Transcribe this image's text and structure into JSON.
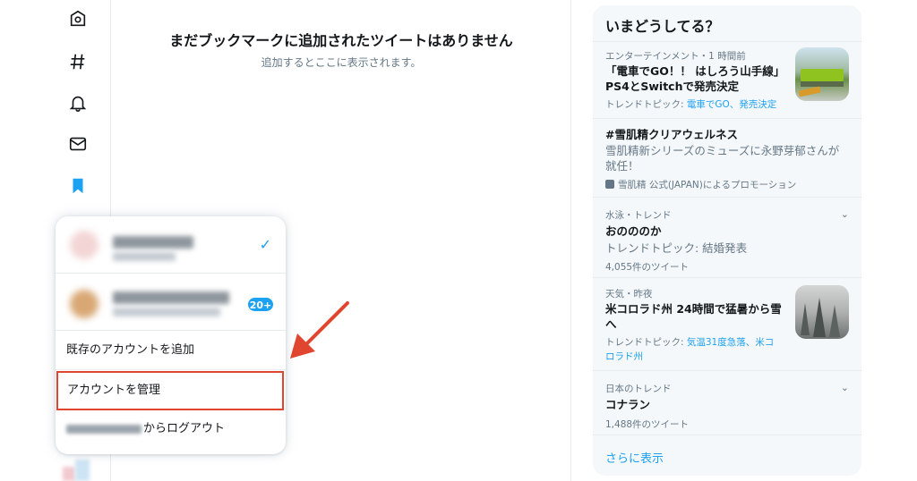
{
  "nav": {
    "icons": [
      "home-icon",
      "hashtag-icon",
      "bell-icon",
      "mail-icon",
      "bookmark-icon"
    ]
  },
  "bookmarks": {
    "empty_title": "まだブックマークに追加されたツイートはありません",
    "empty_sub": "追加するとここに表示されます。"
  },
  "account_menu": {
    "badge": "20+",
    "check": "✓",
    "add_existing": "既存のアカウントを追加",
    "manage": "アカウントを管理",
    "logout_suffix": "からログアウト"
  },
  "trends": {
    "title": "いまどうしてる？",
    "items": [
      {
        "meta": "エンターテインメント・1 時間前",
        "name_line1": "「電車でGO！！ はしろう山手線」",
        "name_line2": "PS4とSwitchで発売決定",
        "desc_prefix": "トレンドトピック: ",
        "desc_links": "電車でGO、発売決定"
      },
      {
        "name": "#雪肌精クリアウェルネス",
        "desc_line1": "雪肌精新シリーズのミューズに永野芽郁さんが",
        "desc_line2": "就任！",
        "promo": "雪肌精 公式(JAPAN)によるプロモーション"
      },
      {
        "meta": "水泳・トレンド",
        "name": "おのののか",
        "desc": "トレンドトピック: 結婚発表",
        "count": "4,055件のツイート"
      },
      {
        "meta": "天気・昨夜",
        "name_line1": "米コロラド州 24時間で猛暑から雪",
        "name_line2": "へ",
        "desc_prefix": "トレンドトピック: ",
        "desc_links_line1": "気温31度急落、米コ",
        "desc_links_line2": "ロラド州"
      },
      {
        "meta": "日本のトレンド",
        "name": "コナラン",
        "count": "1,488件のツイート"
      }
    ],
    "show_more": "さらに表示"
  },
  "colors": {
    "accent": "#1da1f2",
    "annotation": "#e0462f",
    "secondary_text": "#657786",
    "panel_bg": "#f5f8fa"
  }
}
